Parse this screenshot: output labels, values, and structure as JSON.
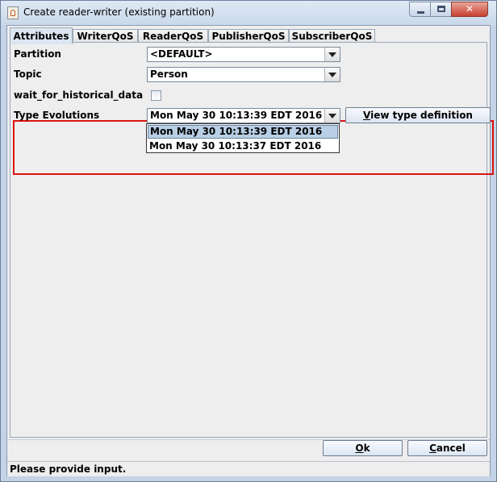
{
  "window": {
    "title": "Create reader-writer (existing partition)",
    "controls": {
      "minimize": "minimize",
      "maximize": "maximize",
      "close": "✕"
    }
  },
  "tabs": [
    {
      "label": "Attributes",
      "active": true
    },
    {
      "label": "WriterQoS",
      "active": false
    },
    {
      "label": "ReaderQoS",
      "active": false
    },
    {
      "label": "PublisherQoS",
      "active": false
    },
    {
      "label": "SubscriberQoS",
      "active": false
    }
  ],
  "form": {
    "partition": {
      "label": "Partition",
      "value": "<DEFAULT>"
    },
    "topic": {
      "label": "Topic",
      "value": "Person"
    },
    "wait_for_historical_data": {
      "label": "wait_for_historical_data",
      "checked": false
    },
    "type_evolutions": {
      "label": "Type Evolutions",
      "value": "Mon May 30 10:13:39 EDT 2016",
      "options": [
        "Mon May 30 10:13:39 EDT 2016",
        "Mon May 30 10:13:37 EDT 2016"
      ],
      "selected_index": 0
    },
    "view_type_definition": {
      "label": "View type definition",
      "mnemonic": "V",
      "rest": "iew type definition"
    }
  },
  "buttons": {
    "ok": {
      "mnemonic": "O",
      "rest": "k"
    },
    "cancel": {
      "mnemonic": "C",
      "rest": "ancel"
    }
  },
  "status": {
    "text": "Please provide input."
  },
  "colors": {
    "highlight": "#dd1111",
    "selected_option": "#b8cfe5",
    "window_frame": "#c4d3e6"
  }
}
